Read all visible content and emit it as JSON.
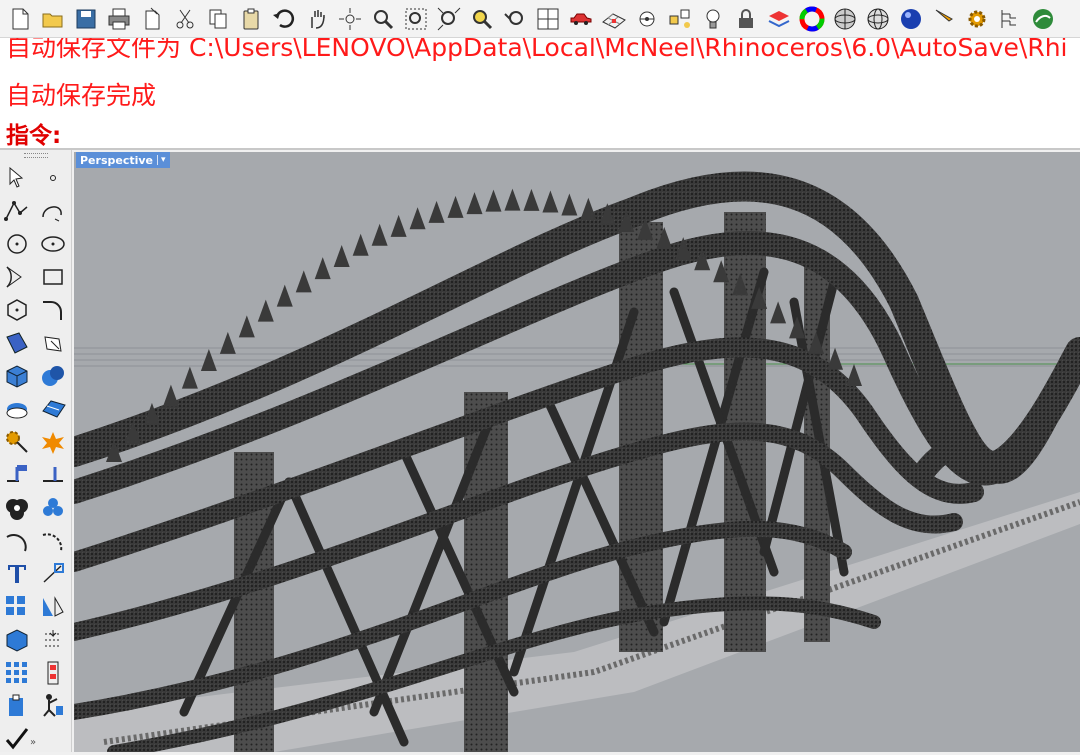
{
  "toolbar": {
    "icons": [
      "new-file-icon",
      "open-folder-icon",
      "save-icon",
      "print-icon",
      "import-icon",
      "cut-icon",
      "copy-icon",
      "paste-icon",
      "undo-icon",
      "pan-hand-icon",
      "rotate-view-icon",
      "zoom-icon",
      "zoom-window-icon",
      "zoom-extents-icon",
      "zoom-selected-icon",
      "undo-view-icon",
      "four-viewports-icon",
      "car-icon",
      "grid-icon",
      "cplane-icon",
      "osnap-icon",
      "light-bulb-icon",
      "lock-icon",
      "layer-icon",
      "color-wheel-icon",
      "sphere-wire-icon",
      "sphere-grid-icon",
      "render-sphere-icon",
      "pencil-icon",
      "gear-icon",
      "tree-icon",
      "globe-icon"
    ]
  },
  "command_history": {
    "clipped_line": "自动保存文件为 C:\\Users\\LENOVO\\AppData\\Local\\McNeel\\Rhinoceros\\6.0\\AutoSave\\Rhi",
    "last_line": "自动保存完成"
  },
  "command_prompt": {
    "label": "指令:",
    "value": ""
  },
  "viewport": {
    "name": "Perspective",
    "caret": "▾"
  },
  "palette": {
    "icons": [
      "select-arrow-icon",
      "point-icon",
      "polyline-icon",
      "curve-icon",
      "circle-icon",
      "ellipse-icon",
      "arc-icon",
      "rectangle-icon",
      "polygon-icon",
      "fillet-curve-icon",
      "surface-icon",
      "surface-edit-icon",
      "box-solid-icon",
      "sphere-solid-icon",
      "mesh-icon",
      "surface-patch-icon",
      "transform-gear-icon",
      "explode-icon",
      "split-icon",
      "trim-icon",
      "boolean-icon",
      "points-icon",
      "arc-tool-icon",
      "arc-dash-icon",
      "text-icon",
      "dimension-icon",
      "array-icon",
      "mirror-icon",
      "solid-edit-icon",
      "analyze-icon",
      "grid-array-icon",
      "block-icon",
      "clipboard-icon",
      "rig-icon",
      "check-icon"
    ],
    "more": "»"
  },
  "colors": {
    "history_text": "#ff1a1a",
    "prompt_text": "#e00000",
    "viewport_bg": "#a6a9ad",
    "viewport_tab": "#5b8fd8",
    "structure": "#2b2b2b"
  }
}
